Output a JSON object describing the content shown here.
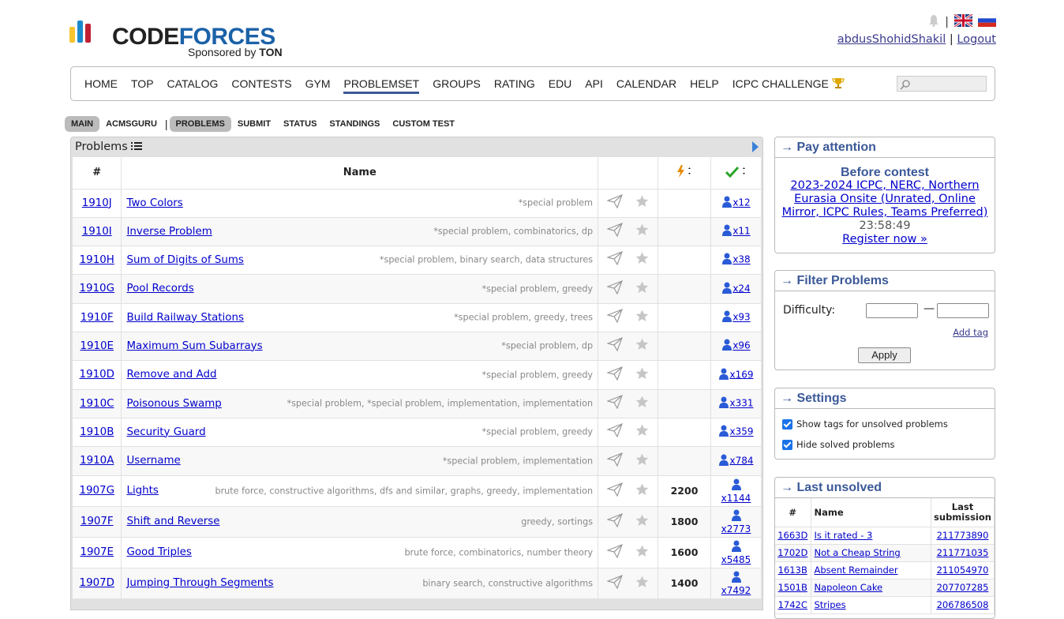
{
  "brand": {
    "name_a": "CODE",
    "name_b": "FORCES",
    "sponsor_prefix": "Sponsored by ",
    "sponsor_name": "TON"
  },
  "user": {
    "handle": "abdusShohidShakil",
    "separator": "|",
    "logout": "Logout"
  },
  "menu": [
    "HOME",
    "TOP",
    "CATALOG",
    "CONTESTS",
    "GYM",
    "PROBLEMSET",
    "GROUPS",
    "RATING",
    "EDU",
    "API",
    "CALENDAR",
    "HELP",
    "ICPC CHALLENGE"
  ],
  "submenu": {
    "main": "MAIN",
    "acmsguru": "ACMSGURU",
    "pipe": "|",
    "problems": "PROBLEMS",
    "submit": "SUBMIT",
    "status": "STATUS",
    "standings": "STANDINGS",
    "custom": "CUSTOM TEST"
  },
  "problems": {
    "title": "Problems",
    "headers": {
      "id": "#",
      "name": "Name"
    },
    "rows": [
      {
        "id": "1910J",
        "name": "Two Colors",
        "tags": "*special problem",
        "diff": "",
        "solved": "x12"
      },
      {
        "id": "1910I",
        "name": "Inverse Problem",
        "tags": "*special problem, combinatorics, dp",
        "diff": "",
        "solved": "x11"
      },
      {
        "id": "1910H",
        "name": "Sum of Digits of Sums",
        "tags": "*special problem, binary search, data structures",
        "diff": "",
        "solved": "x38"
      },
      {
        "id": "1910G",
        "name": "Pool Records",
        "tags": "*special problem, greedy",
        "diff": "",
        "solved": "x24"
      },
      {
        "id": "1910F",
        "name": "Build Railway Stations",
        "tags": "*special problem, greedy, trees",
        "diff": "",
        "solved": "x93"
      },
      {
        "id": "1910E",
        "name": "Maximum Sum Subarrays",
        "tags": "*special problem, dp",
        "diff": "",
        "solved": "x96"
      },
      {
        "id": "1910D",
        "name": "Remove and Add",
        "tags": "*special problem, greedy",
        "diff": "",
        "solved": "x169"
      },
      {
        "id": "1910C",
        "name": "Poisonous Swamp",
        "tags": "*special problem, *special problem, implementation, implementation",
        "diff": "",
        "solved": "x331"
      },
      {
        "id": "1910B",
        "name": "Security Guard",
        "tags": "*special problem, greedy",
        "diff": "",
        "solved": "x359"
      },
      {
        "id": "1910A",
        "name": "Username",
        "tags": "*special problem, implementation",
        "diff": "",
        "solved": "x784"
      },
      {
        "id": "1907G",
        "name": "Lights",
        "tags": "brute force, constructive algorithms, dfs and similar, graphs, greedy, implementation",
        "diff": "2200",
        "solved": "x1144"
      },
      {
        "id": "1907F",
        "name": "Shift and Reverse",
        "tags": "greedy, sortings",
        "diff": "1800",
        "solved": "x2773"
      },
      {
        "id": "1907E",
        "name": "Good Triples",
        "tags": "brute force, combinatorics, number theory",
        "diff": "1600",
        "solved": "x5485"
      },
      {
        "id": "1907D",
        "name": "Jumping Through Segments",
        "tags": "binary search, constructive algorithms",
        "diff": "1400",
        "solved": "x7492"
      }
    ]
  },
  "pay_attention": {
    "title": "→ Pay attention",
    "before": "Before contest",
    "contest": "2023-2024 ICPC, NERC, Northern Eurasia Onsite (Unrated, Online Mirror, ICPC Rules, Teams Preferred)",
    "timer": "23:58:49",
    "register": "Register now »"
  },
  "filter": {
    "title": "→ Filter Problems",
    "difficulty": "Difficulty:",
    "dash": "—",
    "add_tag": "Add tag",
    "apply": "Apply"
  },
  "settings": {
    "title": "→ Settings",
    "opt1": "Show tags for unsolved problems",
    "opt2": "Hide solved problems"
  },
  "last_unsolved": {
    "title": "→ Last unsolved",
    "h_id": "#",
    "h_name": "Name",
    "h_last1": "Last",
    "h_last2": "submission",
    "rows": [
      {
        "id": "1663D",
        "name": "Is it rated - 3",
        "sub": "211773890"
      },
      {
        "id": "1702D",
        "name": "Not a Cheap String",
        "sub": "211771035"
      },
      {
        "id": "1613B",
        "name": "Absent Remainder",
        "sub": "211054970"
      },
      {
        "id": "1501B",
        "name": "Napoleon Cake",
        "sub": "207707285"
      },
      {
        "id": "1742C",
        "name": "Stripes",
        "sub": "206786508"
      }
    ]
  }
}
